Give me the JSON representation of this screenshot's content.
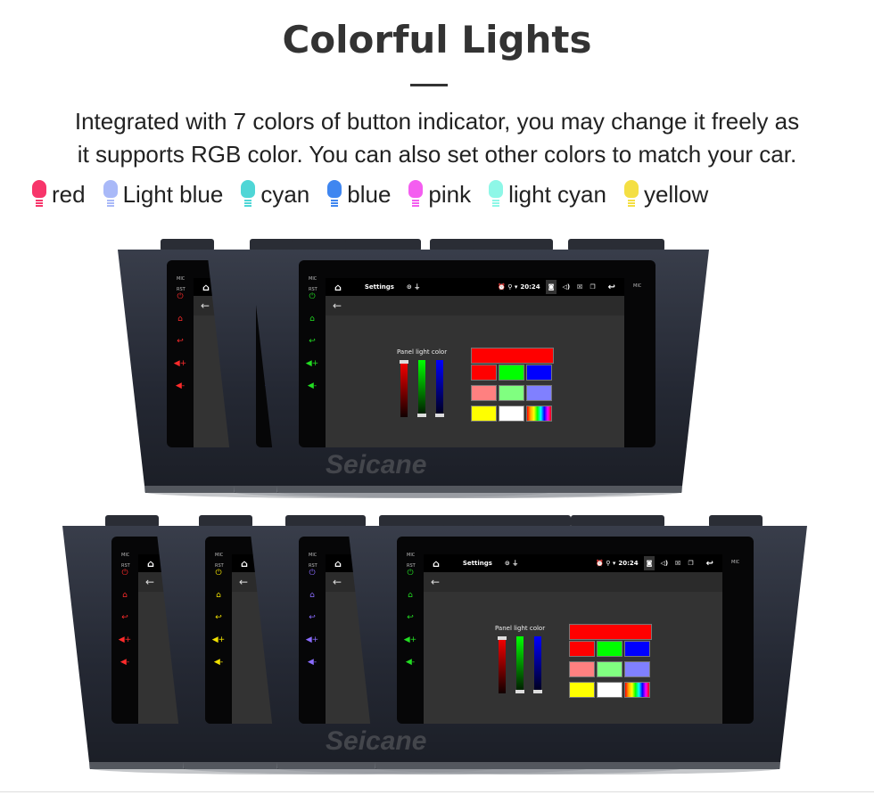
{
  "title": "Colorful Lights",
  "description": [
    "Integrated with 7 colors of button indicator, you may change it freely as",
    "it supports RGB color. You can also set other colors to match your car."
  ],
  "legend": [
    {
      "label": "red",
      "color": "#f7356a"
    },
    {
      "label": "Light blue",
      "color": "#a9b9f8"
    },
    {
      "label": "cyan",
      "color": "#4fd6d6"
    },
    {
      "label": "blue",
      "color": "#3f86f0"
    },
    {
      "label": "pink",
      "color": "#f45ef0"
    },
    {
      "label": "light cyan",
      "color": "#8ef7e7"
    },
    {
      "label": "yellow",
      "color": "#f4df43"
    }
  ],
  "screen": {
    "mic": "MIC",
    "rst": "RST",
    "app_title": "Settings",
    "time": "20:24",
    "panel_label": "Panel light color",
    "swatches": [
      "#ff0000",
      "#ff0000",
      "#00ff00",
      "#0000ff",
      "#ff8080",
      "#80ff80",
      "#8080ff",
      "#ffff00",
      "#ffffff",
      "rainbow"
    ]
  },
  "devices_top": [
    {
      "button_color": "#ff2b2b"
    },
    {
      "button_color": "#2b3dff"
    },
    {
      "button_color": "#22dd22"
    }
  ],
  "devices_bottom": [
    {
      "button_color": "#ff2b2b"
    },
    {
      "button_color": "#f0e000"
    },
    {
      "button_color": "#8a6cff"
    },
    {
      "button_color": "#22dd22"
    }
  ],
  "watermark": "Seicane"
}
